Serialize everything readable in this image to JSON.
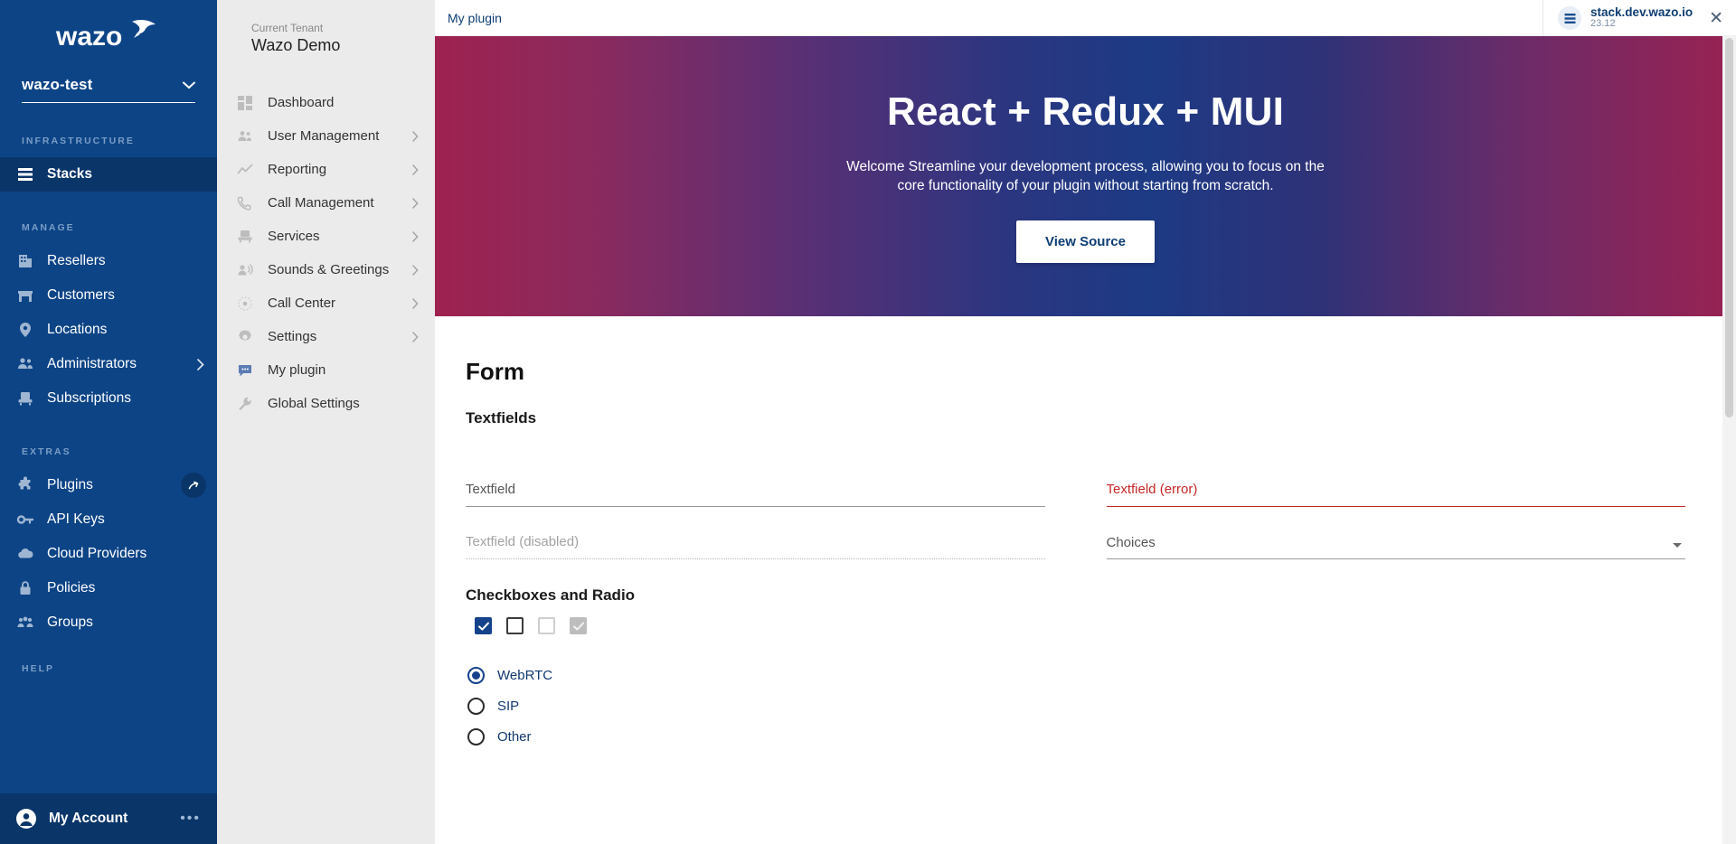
{
  "brand": {
    "logo_text": "wazo",
    "primary_color": "#0d4486",
    "accent_color": "#14428b",
    "error_color": "#c62828"
  },
  "primary_nav": {
    "tenant_switcher": {
      "value": "wazo-test",
      "icon": "chevron-down-icon"
    },
    "sections": [
      {
        "title": "INFRASTRUCTURE",
        "items": [
          {
            "label": "Stacks",
            "icon": "stack-icon",
            "active": true,
            "expandable": false
          }
        ]
      },
      {
        "title": "MANAGE",
        "items": [
          {
            "label": "Resellers",
            "icon": "building-icon",
            "active": false,
            "expandable": false
          },
          {
            "label": "Customers",
            "icon": "store-icon",
            "active": false,
            "expandable": false
          },
          {
            "label": "Locations",
            "icon": "map-pin-icon",
            "active": false,
            "expandable": false
          },
          {
            "label": "Administrators",
            "icon": "people-icon",
            "active": false,
            "expandable": true
          },
          {
            "label": "Subscriptions",
            "icon": "subscription-icon",
            "active": false,
            "expandable": false
          }
        ]
      },
      {
        "title": "EXTRAS",
        "items": [
          {
            "label": "Plugins",
            "icon": "puzzle-icon",
            "active": false,
            "expandable": false,
            "badge": "arrow-up-right-icon"
          },
          {
            "label": "API Keys",
            "icon": "key-icon",
            "active": false,
            "expandable": false
          },
          {
            "label": "Cloud Providers",
            "icon": "cloud-icon",
            "active": false,
            "expandable": false
          },
          {
            "label": "Policies",
            "icon": "lock-icon",
            "active": false,
            "expandable": false
          },
          {
            "label": "Groups",
            "icon": "groups-icon",
            "active": false,
            "expandable": false
          }
        ]
      },
      {
        "title": "HELP",
        "items": []
      }
    ],
    "account": {
      "label": "My Account",
      "icon": "account-circle-icon",
      "overflow": "ellipsis-icon"
    }
  },
  "secondary_nav": {
    "tenant_caption": "Current Tenant",
    "tenant_name": "Wazo Demo",
    "items": [
      {
        "label": "Dashboard",
        "icon": "dashboard-icon",
        "expandable": false
      },
      {
        "label": "User Management",
        "icon": "people-icon",
        "expandable": true
      },
      {
        "label": "Reporting",
        "icon": "chart-line-icon",
        "expandable": true
      },
      {
        "label": "Call Management",
        "icon": "phone-icon",
        "expandable": true
      },
      {
        "label": "Services",
        "icon": "services-icon",
        "expandable": true
      },
      {
        "label": "Sounds & Greetings",
        "icon": "sound-person-icon",
        "expandable": true
      },
      {
        "label": "Call Center",
        "icon": "call-center-icon",
        "expandable": true
      },
      {
        "label": "Settings",
        "icon": "gear-icon",
        "expandable": true
      },
      {
        "label": "My plugin",
        "icon": "chat-plugin-icon",
        "expandable": false
      },
      {
        "label": "Global Settings",
        "icon": "wrench-icon",
        "expandable": false
      }
    ]
  },
  "topbar": {
    "breadcrumb": "My plugin",
    "stack": {
      "name": "stack.dev.wazo.io",
      "version": "23.12",
      "icon": "stack-icon",
      "close": "close-icon"
    }
  },
  "hero": {
    "title": "React + Redux + MUI",
    "description": "Welcome Streamline your development process, allowing you to focus on the core functionality of your plugin without starting from scratch.",
    "button_label": "View Source",
    "gradient_from": "#9e2250",
    "gradient_mid": "#1d3a84",
    "gradient_to": "#992252"
  },
  "form": {
    "title": "Form",
    "textfields_heading": "Textfields",
    "fields": [
      {
        "name": "textfield",
        "value": "Textfield",
        "state": "normal"
      },
      {
        "name": "textfield-error",
        "value": "Textfield (error)",
        "state": "error"
      },
      {
        "name": "textfield-disabled",
        "value": "Textfield (disabled)",
        "state": "disabled"
      },
      {
        "name": "choices-select",
        "value": "Choices",
        "state": "select"
      }
    ],
    "checkbox_heading": "Checkboxes and Radio",
    "checkboxes": [
      {
        "name": "checkbox-checked",
        "checked": true,
        "disabled": false
      },
      {
        "name": "checkbox-unchecked",
        "checked": false,
        "disabled": false
      },
      {
        "name": "checkbox-unchecked-disabled",
        "checked": false,
        "disabled": true
      },
      {
        "name": "checkbox-checked-disabled",
        "checked": true,
        "disabled": true
      }
    ],
    "radios": [
      {
        "name": "radio-webrtc",
        "label": "WebRTC",
        "selected": true
      },
      {
        "name": "radio-sip",
        "label": "SIP",
        "selected": false
      },
      {
        "name": "radio-other",
        "label": "Other",
        "selected": false
      }
    ]
  }
}
